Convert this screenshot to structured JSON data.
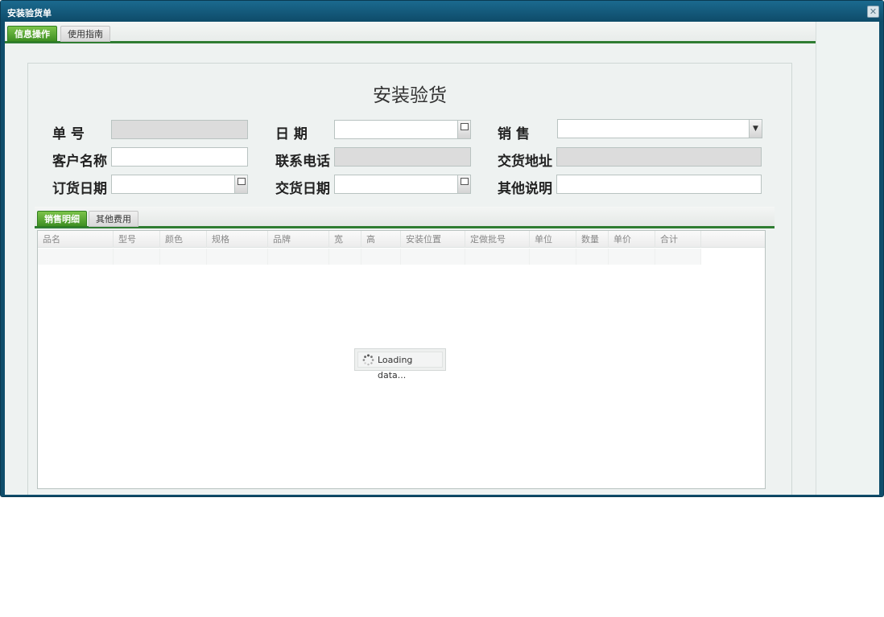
{
  "window": {
    "title": "安装验货单",
    "close_glyph": "✕"
  },
  "tabs": [
    {
      "label": "信息操作"
    },
    {
      "label": "使用指南"
    }
  ],
  "form": {
    "title": "安装验货",
    "order_no_label": "单 号",
    "date_label": "日 期",
    "sales_label": "销 售",
    "customer_label": "客户名称",
    "phone_label": "联系电话",
    "delivery_address_label": "交货地址",
    "order_date_label": "订货日期",
    "delivery_date_label": "交货日期",
    "other_label": "其他说明",
    "values": {
      "order_no": "",
      "date": "",
      "sales": "",
      "customer": "",
      "phone": "",
      "delivery_address": "",
      "order_date": "",
      "delivery_date": "",
      "other": ""
    }
  },
  "inner_tabs": [
    {
      "label": "销售明细"
    },
    {
      "label": "其他费用"
    }
  ],
  "grid": {
    "columns": [
      "品名",
      "型号",
      "颜色",
      "规格",
      "品牌",
      "宽",
      "高",
      "安装位置",
      "定做批号",
      "单位",
      "数量",
      "单价",
      "合计"
    ],
    "loading_text": "Loading data..."
  },
  "colors": {
    "accent_green": "#2f7d32",
    "title_bar": "#0f4d6b"
  },
  "icons": {
    "date": "calendar-icon",
    "combo": "chevron-down-icon",
    "spinner": "loading-spinner-icon"
  }
}
